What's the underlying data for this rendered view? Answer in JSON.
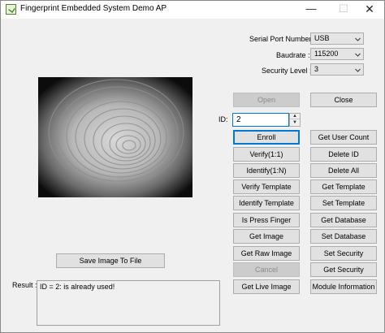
{
  "window": {
    "title": "Fingerprint Embedded System Demo AP",
    "minimize_glyph": "—",
    "maximize_glyph": "☐",
    "close_glyph": "✕"
  },
  "settings": {
    "serial_port_label": "Serial Port Number :",
    "serial_port_value": "USB",
    "baudrate_label": "Baudrate :",
    "baudrate_value": "115200",
    "security_label": "Security Level :",
    "security_value": "3"
  },
  "connection": {
    "open_label": "Open",
    "close_label": "Close"
  },
  "id_field": {
    "label": "ID:",
    "value": "2"
  },
  "buttons_left": [
    "Enroll",
    "Verify(1:1)",
    "Identify(1:N)",
    "Verify Template",
    "Identify Template",
    "Is Press Finger",
    "Get Image",
    "Get Raw Image",
    "Cancel",
    "Get Live Image"
  ],
  "buttons_right": [
    "Get User Count",
    "Delete ID",
    "Delete All",
    "Get Template",
    "Set Template",
    "Get Database",
    "Set Database",
    "Set Security",
    "Get Security",
    "Module Information"
  ],
  "save_image_label": "Save Image To File",
  "result": {
    "label": "Result :",
    "text": "ID = 2: is already used!"
  },
  "icons": {
    "app": "fingerprint-app-icon",
    "dropdown": "chevron-down-icon"
  },
  "colors": {
    "window_bg": "#f0f0f0",
    "focus_border": "#0078d7",
    "button_bg": "#e1e1e1"
  }
}
